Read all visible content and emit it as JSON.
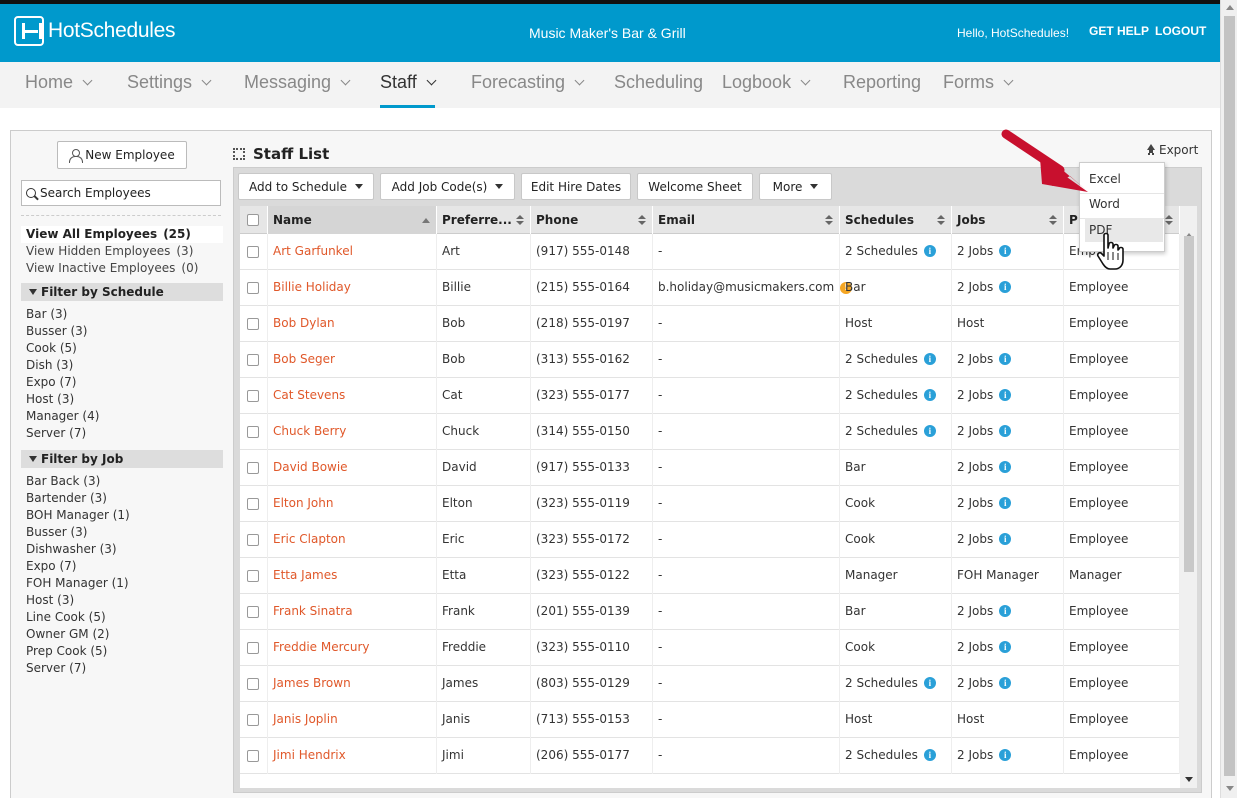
{
  "header": {
    "brand": "HotSchedules",
    "venue": "Music Maker's Bar & Grill",
    "greeting": "Hello, HotSchedules!",
    "help_label": "GET HELP",
    "logout_label": "LOGOUT",
    "bg_color": "#0099cc"
  },
  "nav": {
    "items": [
      {
        "label": "Home",
        "dropdown": true
      },
      {
        "label": "Settings",
        "dropdown": true
      },
      {
        "label": "Messaging",
        "dropdown": true
      },
      {
        "label": "Staff",
        "dropdown": true,
        "active": true
      },
      {
        "label": "Forecasting",
        "dropdown": true
      },
      {
        "label": "Scheduling",
        "dropdown": false
      },
      {
        "label": "Logbook",
        "dropdown": true
      },
      {
        "label": "Reporting",
        "dropdown": false
      },
      {
        "label": "Forms",
        "dropdown": true
      }
    ]
  },
  "sidebar": {
    "new_employee_label": "New Employee",
    "search_placeholder": "Search Employees",
    "views": [
      {
        "label": "View All Employees",
        "count": "(25)",
        "active": true
      },
      {
        "label": "View Hidden Employees",
        "count": "(3)",
        "active": false
      },
      {
        "label": "View Inactive Employees",
        "count": "(0)",
        "active": false
      }
    ],
    "filter_schedule": {
      "title": "Filter by Schedule",
      "items": [
        "Bar (3)",
        "Busser (3)",
        "Cook (5)",
        "Dish (3)",
        "Expo (7)",
        "Host (3)",
        "Manager (4)",
        "Server (7)"
      ]
    },
    "filter_job": {
      "title": "Filter by Job",
      "items": [
        "Bar Back (3)",
        "Bartender (3)",
        "BOH Manager (1)",
        "Busser (3)",
        "Dishwasher (3)",
        "Expo (7)",
        "FOH Manager (1)",
        "Host (3)",
        "Line Cook (5)",
        "Owner GM (2)",
        "Prep Cook (5)",
        "Server (7)"
      ]
    }
  },
  "main": {
    "title": "Staff List",
    "export_label": "Export",
    "toolbar": {
      "add_schedule": "Add to Schedule",
      "add_job": "Add Job Code(s)",
      "edit_hire": "Edit Hire Dates",
      "welcome": "Welcome Sheet",
      "more": "More"
    },
    "export_menu": [
      "Excel",
      "Word",
      "PDF"
    ],
    "columns": [
      "Name",
      "Preferre...",
      "Phone",
      "Email",
      "Schedules",
      "Jobs",
      "P"
    ],
    "rows": [
      {
        "name": "Art Garfunkel",
        "pref": "Art",
        "phone": "(917) 555-0148",
        "email": "-",
        "schedules": "2 Schedules",
        "sched_info": true,
        "jobs": "2 Jobs",
        "jobs_info": true,
        "p": "Emp"
      },
      {
        "name": "Billie Holiday",
        "pref": "Billie",
        "phone": "(215) 555-0164",
        "email": "b.holiday@musicmakers.com",
        "email_warn": true,
        "schedules": "Bar",
        "sched_info": false,
        "jobs": "2 Jobs",
        "jobs_info": true,
        "p": "Employee"
      },
      {
        "name": "Bob Dylan",
        "pref": "Bob",
        "phone": "(218) 555-0197",
        "email": "-",
        "schedules": "Host",
        "sched_info": false,
        "jobs": "Host",
        "jobs_info": false,
        "p": "Employee"
      },
      {
        "name": "Bob Seger",
        "pref": "Bob",
        "phone": "(313) 555-0162",
        "email": "-",
        "schedules": "2 Schedules",
        "sched_info": true,
        "jobs": "2 Jobs",
        "jobs_info": true,
        "p": "Employee"
      },
      {
        "name": "Cat Stevens",
        "pref": "Cat",
        "phone": "(323) 555-0177",
        "email": "-",
        "schedules": "2 Schedules",
        "sched_info": true,
        "jobs": "2 Jobs",
        "jobs_info": true,
        "p": "Employee"
      },
      {
        "name": "Chuck Berry",
        "pref": "Chuck",
        "phone": "(314) 555-0150",
        "email": "-",
        "schedules": "2 Schedules",
        "sched_info": true,
        "jobs": "2 Jobs",
        "jobs_info": true,
        "p": "Employee"
      },
      {
        "name": "David Bowie",
        "pref": "David",
        "phone": "(917) 555-0133",
        "email": "-",
        "schedules": "Bar",
        "sched_info": false,
        "jobs": "2 Jobs",
        "jobs_info": true,
        "p": "Employee"
      },
      {
        "name": "Elton John",
        "pref": "Elton",
        "phone": "(323) 555-0119",
        "email": "-",
        "schedules": "Cook",
        "sched_info": false,
        "jobs": "2 Jobs",
        "jobs_info": true,
        "p": "Employee"
      },
      {
        "name": "Eric Clapton",
        "pref": "Eric",
        "phone": "(323) 555-0172",
        "email": "-",
        "schedules": "Cook",
        "sched_info": false,
        "jobs": "2 Jobs",
        "jobs_info": true,
        "p": "Employee"
      },
      {
        "name": "Etta James",
        "pref": "Etta",
        "phone": "(323) 555-0122",
        "email": "-",
        "schedules": "Manager",
        "sched_info": false,
        "jobs": "FOH Manager",
        "jobs_info": false,
        "p": "Manager"
      },
      {
        "name": "Frank Sinatra",
        "pref": "Frank",
        "phone": "(201) 555-0139",
        "email": "-",
        "schedules": "Bar",
        "sched_info": false,
        "jobs": "2 Jobs",
        "jobs_info": true,
        "p": "Employee"
      },
      {
        "name": "Freddie Mercury",
        "pref": "Freddie",
        "phone": "(323) 555-0110",
        "email": "-",
        "schedules": "Cook",
        "sched_info": false,
        "jobs": "2 Jobs",
        "jobs_info": true,
        "p": "Employee"
      },
      {
        "name": "James Brown",
        "pref": "James",
        "phone": "(803) 555-0129",
        "email": "-",
        "schedules": "2 Schedules",
        "sched_info": true,
        "jobs": "2 Jobs",
        "jobs_info": true,
        "p": "Employee"
      },
      {
        "name": "Janis Joplin",
        "pref": "Janis",
        "phone": "(713) 555-0153",
        "email": "-",
        "schedules": "Host",
        "sched_info": false,
        "jobs": "Host",
        "jobs_info": false,
        "p": "Employee"
      },
      {
        "name": "Jimi Hendrix",
        "pref": "Jimi",
        "phone": "(206) 555-0177",
        "email": "-",
        "schedules": "2 Schedules",
        "sched_info": true,
        "jobs": "2 Jobs",
        "jobs_info": true,
        "p": "Employee"
      }
    ],
    "link_color": "#e0582a",
    "info_color": "#2aa0d8",
    "warn_color": "#f5a623",
    "arrow_color": "#c8102e"
  },
  "icons": [
    "logo-icon",
    "person-add-icon",
    "search-icon",
    "expand-icon",
    "export-icon",
    "sort-icon",
    "info-icon",
    "warning-icon",
    "hand-cursor-icon",
    "arrow-annotation-icon"
  ]
}
